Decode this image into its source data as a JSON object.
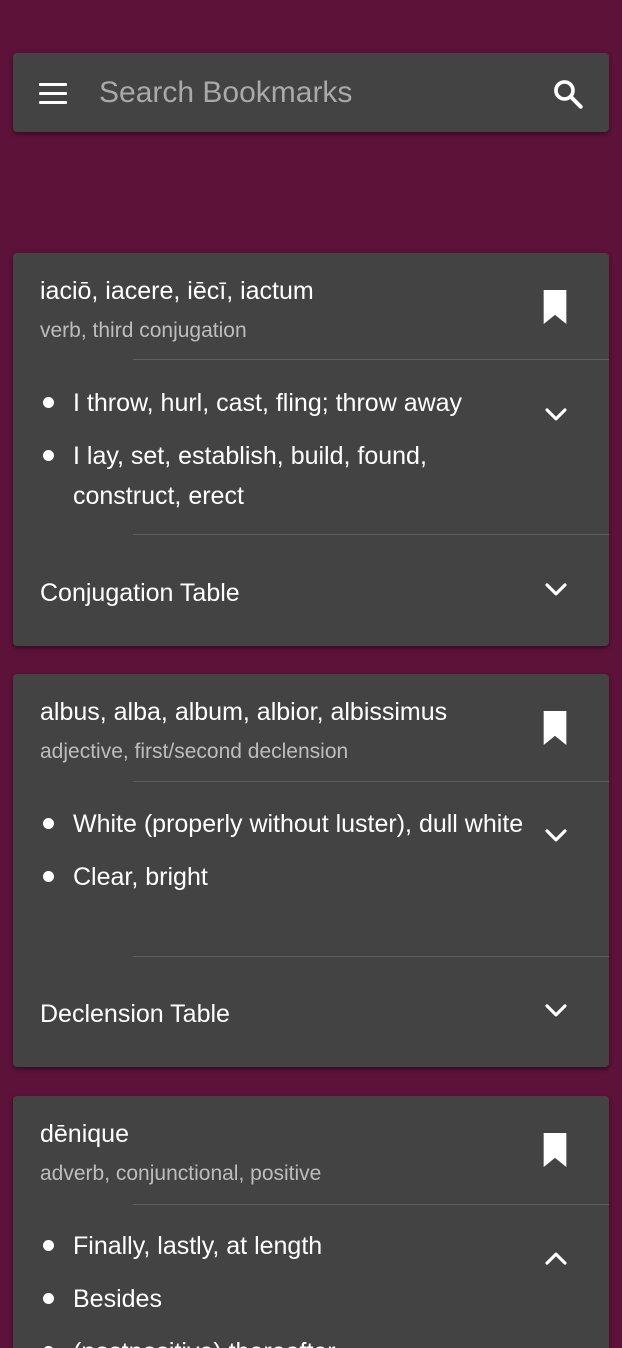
{
  "search": {
    "placeholder": "Search Bookmarks"
  },
  "entries": [
    {
      "headword": "iaciō, iacere, iēcī, iactum",
      "subtitle": "verb, third conjugation",
      "definitions": [
        "I throw, hurl, cast, fling; throw away",
        "I lay, set, establish, build, found, construct, erect"
      ],
      "table_label": "Conjugation Table"
    },
    {
      "headword": "albus, alba, album, albior, albissimus",
      "subtitle": "adjective, first/second declension",
      "definitions": [
        "White (properly without luster), dull white",
        "Clear, bright"
      ],
      "table_label": "Declension Table"
    },
    {
      "headword": "dēnique",
      "subtitle": "adverb, conjunctional, positive",
      "definitions": [
        "Finally, lastly, at length",
        "Besides",
        "(postpositive) thereafter"
      ]
    }
  ],
  "icons": {
    "menu": "menu-icon",
    "search": "search-icon",
    "bookmark": "bookmark-icon",
    "expand": "chevron-down-icon",
    "collapse": "chevron-up-icon"
  },
  "colors": {
    "background": "#5d1239",
    "card": "#434343",
    "subtitle": "#bdbdbd"
  }
}
